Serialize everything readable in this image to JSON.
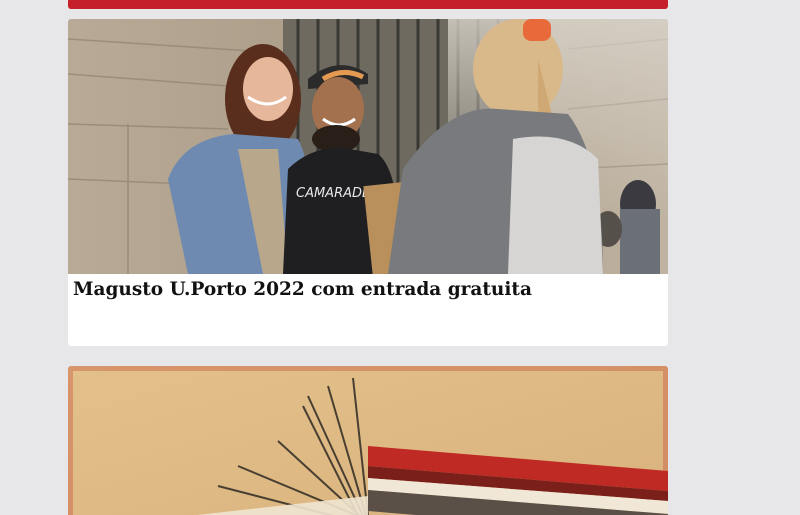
{
  "articles": [
    {
      "title": "Magusto U.Porto 2022 com entrada gratuita",
      "image_subject": "students-at-magusto-photo",
      "image_text": "CAMARADE"
    },
    {
      "title": "",
      "image_subject": "abstract-painting-illustration"
    }
  ],
  "colors": {
    "accent_bar": "#c51f2a",
    "page_background": "#e7e6e8",
    "card_background": "#ffffff"
  }
}
